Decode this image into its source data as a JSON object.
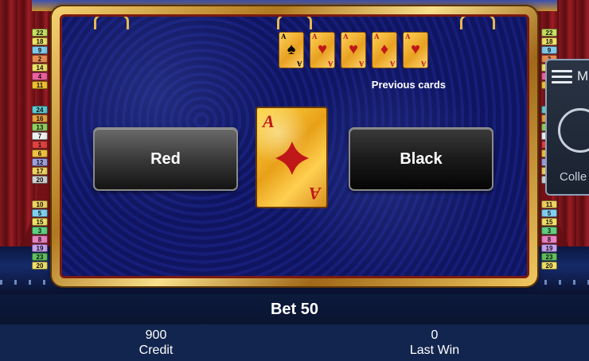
{
  "game": {
    "buttons": {
      "red_label": "Red",
      "black_label": "Black"
    },
    "current_card": {
      "rank": "A",
      "suit": "diamond",
      "suit_color": "#c01818"
    },
    "previous_cards": {
      "label": "Previous cards",
      "cards": [
        {
          "rank": "A",
          "suit_icon": "♠",
          "color": "#000000"
        },
        {
          "rank": "A",
          "suit_icon": "♥",
          "color": "#c01818"
        },
        {
          "rank": "A",
          "suit_icon": "♥",
          "color": "#c01818"
        },
        {
          "rank": "A",
          "suit_icon": "♦",
          "color": "#c01818"
        },
        {
          "rank": "A",
          "suit_icon": "♥",
          "color": "#c01818"
        }
      ]
    },
    "lines_left": [
      "22",
      "18",
      "9",
      "2",
      "14",
      "4",
      "11",
      "24",
      "16",
      "13",
      "7",
      "1",
      "6",
      "12",
      "17",
      "20",
      "10",
      "5",
      "15",
      "3",
      "8",
      "19",
      "23",
      "20"
    ],
    "lines_right": [
      "22",
      "18",
      "9",
      "2",
      "14",
      "4",
      "11",
      "24",
      "16",
      "13",
      "7",
      "1",
      "6",
      "12",
      "17",
      "20",
      "11",
      "5",
      "15",
      "3",
      "8",
      "19",
      "23",
      "20"
    ]
  },
  "side_panel": {
    "menu_label": "M",
    "collect_label": "Colle"
  },
  "footer": {
    "bet_text": "Bet 50",
    "credit_value": "900",
    "credit_label": "Credit",
    "last_win_value": "0",
    "last_win_label": "Last Win"
  },
  "colors": {
    "line_tags": [
      "#c8e060",
      "#f0e068",
      "#80c8e8",
      "#e88a50",
      "#f0e068",
      "#f060a0",
      "#f0c030",
      "#60c8d0",
      "#e8a040",
      "#90d060",
      "#f0f0f0",
      "#e04040",
      "#f0c040",
      "#a0a0e0",
      "#f0d060",
      "#d0d0d0",
      "#f0d060",
      "#80d0f0",
      "#f0e068",
      "#60d080",
      "#e880c0",
      "#c8a0f0",
      "#60c060",
      "#f0e068"
    ]
  }
}
